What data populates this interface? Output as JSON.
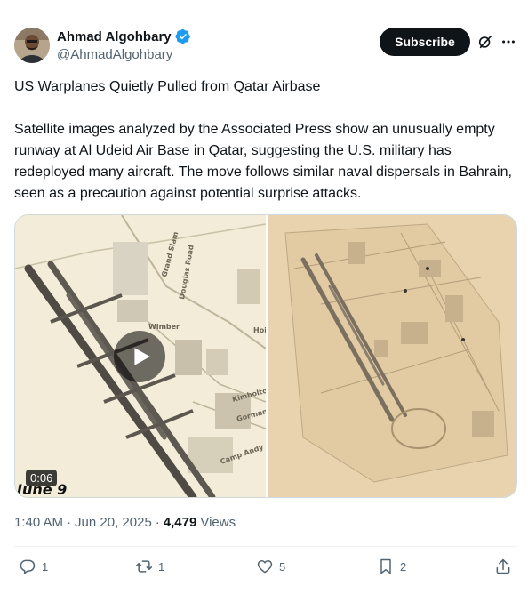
{
  "author": {
    "display_name": "Ahmad Algohbary",
    "handle": "@AhmadAlgohbary",
    "verified": true
  },
  "header": {
    "subscribe_label": "Subscribe",
    "icons": [
      "grok-icon",
      "more-icon"
    ]
  },
  "post": {
    "headline": "US Warplanes Quietly Pulled from Qatar Airbase",
    "body": "Satellite images analyzed by the Associated Press show an unusually empty runway at Al Udeid Air Base in Qatar, suggesting the U.S. military has redeployed many aircraft. The move follows similar naval dispersals in Bahrain, seen as a precaution against potential surprise attacks."
  },
  "media": {
    "video_duration": "0:06",
    "left_caption": "June 9",
    "map_labels": [
      "Grand Slam",
      "Douglas Road",
      "Wimber",
      "Kimbolton",
      "Gorman",
      "Camp Andy",
      "Hoi"
    ]
  },
  "meta": {
    "time": "1:40 AM",
    "date": "Jun 20, 2025",
    "separator": "·",
    "views_count": "4,479",
    "views_label": "Views"
  },
  "actions": {
    "replies": "1",
    "reposts": "1",
    "likes": "5",
    "bookmarks": "2"
  },
  "colors": {
    "accent": "#1d9bf0",
    "text_primary": "#0f1419",
    "text_secondary": "#536471",
    "subscribe_bg": "#0f1419"
  }
}
